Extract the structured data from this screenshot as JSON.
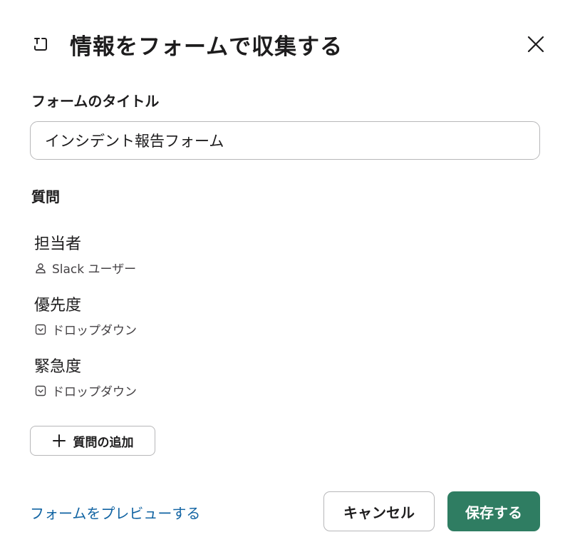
{
  "modal": {
    "title": "情報をフォームで収集する",
    "header_icon": "form-icon",
    "close_icon": "close-icon"
  },
  "form_title": {
    "label": "フォームのタイトル",
    "value": "インシデント報告フォーム"
  },
  "questions": {
    "label": "質問",
    "items": [
      {
        "title": "担当者",
        "type": "Slack ユーザー",
        "type_icon": "user-icon"
      },
      {
        "title": "優先度",
        "type": "ドロップダウン",
        "type_icon": "dropdown-icon"
      },
      {
        "title": "緊急度",
        "type": "ドロップダウン",
        "type_icon": "dropdown-icon"
      }
    ],
    "add_label": "質問の追加"
  },
  "footer": {
    "preview_label": "フォームをプレビューする",
    "cancel_label": "キャンセル",
    "save_label": "保存する"
  },
  "colors": {
    "primary": "#2f7d62",
    "link": "#1264a3",
    "border": "#b7b7b9",
    "text": "#1d1c1d"
  }
}
